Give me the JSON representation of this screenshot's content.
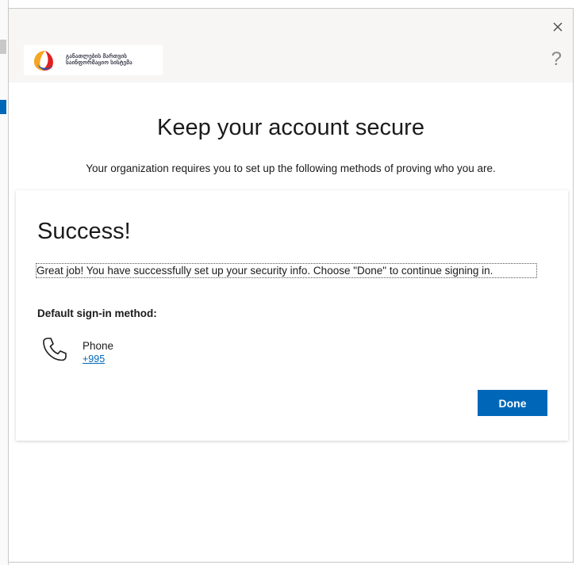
{
  "dialog": {
    "close_icon": "close-icon",
    "help_icon": "help-icon",
    "help_symbol": "?",
    "logo": {
      "line1": "განათლების მართვის",
      "line2": "საინფორმაციო სისტემა",
      "colors": [
        "#f5a623",
        "#e02020",
        "#2a56a8"
      ]
    },
    "title": "Keep your account secure",
    "subtitle": "Your organization requires you to set up the following methods of proving who you are."
  },
  "card": {
    "title": "Success!",
    "message": "Great job! You have successfully set up your security info. Choose \"Done\" to continue signing in.",
    "default_method_label": "Default sign-in method:",
    "method": {
      "icon": "phone-icon",
      "name": "Phone",
      "value": "+995"
    },
    "done_label": "Done"
  },
  "colors": {
    "accent": "#0067b8",
    "topbar": "#f7f6f5"
  }
}
